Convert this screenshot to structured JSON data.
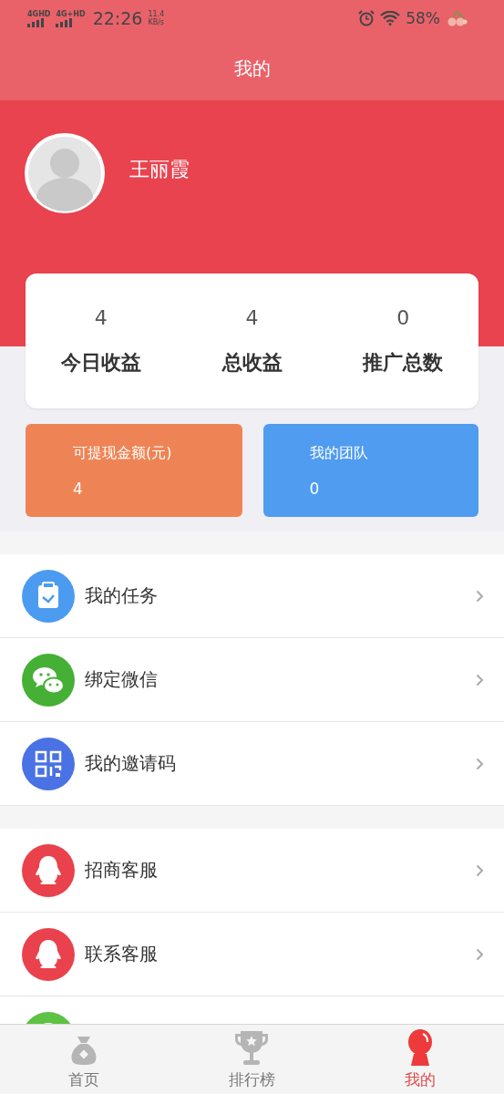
{
  "status_bar": {
    "signal_1": "4GHD",
    "signal_2": "4G+HD",
    "time": "22:26",
    "speed_value": "11.4",
    "speed_unit": "KB/s",
    "battery": "58%"
  },
  "header": {
    "title": "我的"
  },
  "profile": {
    "name": "王丽霞"
  },
  "stats": [
    {
      "value": "4",
      "label": "今日收益"
    },
    {
      "value": "4",
      "label": "总收益"
    },
    {
      "value": "0",
      "label": "推广总数"
    }
  ],
  "cards": [
    {
      "label": "可提现金额(元)",
      "value": "4",
      "color": "#ee8455"
    },
    {
      "label": "我的团队",
      "value": "0",
      "color": "#4f9cf0"
    }
  ],
  "menu_groups": [
    [
      {
        "kind": "task",
        "label": "我的任务"
      },
      {
        "kind": "wechat",
        "label": "绑定微信"
      },
      {
        "kind": "qrcode",
        "label": "我的邀请码"
      }
    ],
    [
      {
        "kind": "penguin",
        "label": "招商客服"
      },
      {
        "kind": "penguin",
        "label": "联系客服"
      },
      {
        "kind": "green"
      }
    ]
  ],
  "tab_bar": [
    {
      "kind": "moneybag",
      "label": "首页",
      "selected": false
    },
    {
      "kind": "trophy",
      "label": "排行榜",
      "selected": false
    },
    {
      "kind": "person",
      "label": "我的",
      "selected": true
    }
  ]
}
